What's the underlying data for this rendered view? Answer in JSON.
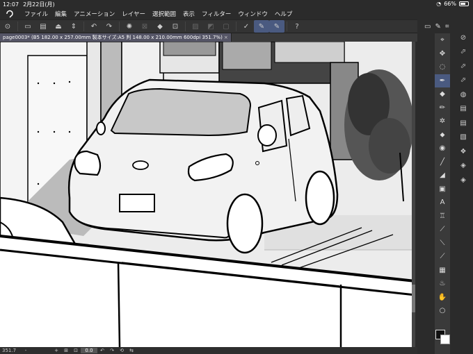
{
  "status": {
    "time": "12:07",
    "date": "2月22日(月)",
    "battery": "66%"
  },
  "menu": [
    "ファイル",
    "編集",
    "アニメーション",
    "レイヤー",
    "選択範囲",
    "表示",
    "フィルター",
    "ウィンドウ",
    "ヘルプ"
  ],
  "tab": {
    "label": "page0003* (B5 182.00 x 257.00mm 製本サイズ:A5 判 148.00 x 210.00mm 600dpi 351.7%)",
    "close": "×"
  },
  "bottom": {
    "zoom": "351.7",
    "minus": "-",
    "plus": "+",
    "rotation": "0.0"
  },
  "toolbar_icons": [
    "app-icon",
    "new-icon",
    "open-icon",
    "save-icon",
    "undo-icon",
    "redo-icon",
    "loading-icon",
    "clear-icon",
    "fill-icon",
    "crop-icon",
    "selection-icon",
    "transparent-icon",
    "pen-icon",
    "brush1-icon",
    "brush2-icon",
    "help-icon"
  ],
  "tools": [
    "select-icon",
    "move-icon",
    "lasso-icon",
    "pen-icon",
    "eraser-icon",
    "pencil-icon",
    "magic-icon",
    "blend-icon",
    "gradient-icon",
    "line-icon",
    "frame-icon",
    "fill-icon",
    "text-icon",
    "balloon-icon",
    "ruler-icon",
    "correct-icon",
    "dropper-icon",
    "pattern-icon",
    "decoration-icon",
    "hand-icon",
    "zoom-icon"
  ],
  "sub_tools": [
    "navigator-icon",
    "layer-prop-icon",
    "sub-tool-icon",
    "brush-size-icon",
    "color-icon",
    "material-icon",
    "layer-icon",
    "layer-search-icon",
    "timeline-icon",
    "history-icon",
    "settings-icon"
  ]
}
